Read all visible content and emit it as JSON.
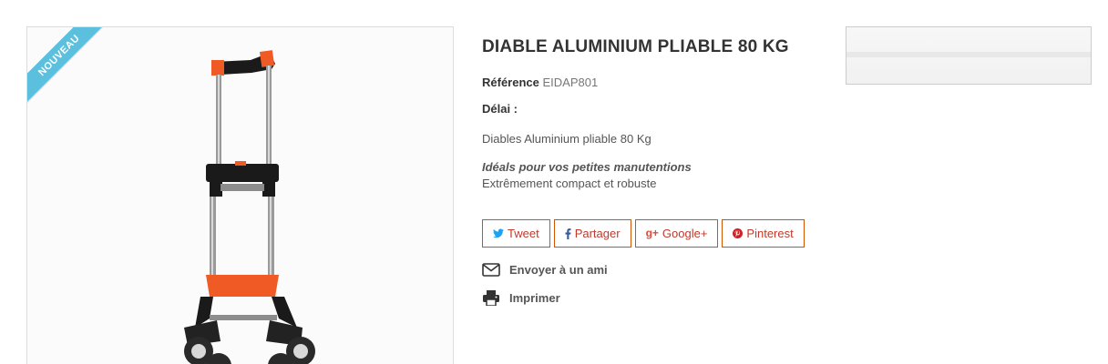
{
  "product": {
    "badge": "NOUVEAU",
    "title": "DIABLE ALUMINIUM PLIABLE 80 KG",
    "reference_label": "Référence",
    "reference_value": "EIDAP801",
    "delai_label": "Délai :",
    "short_description": "Diables Aluminium pliable 80 Kg",
    "highlight": "Idéals pour vos petites manutentions",
    "highlight_sub": "Extrêmement compact et robuste"
  },
  "share": {
    "buttons": [
      {
        "label": "Tweet",
        "icon": "twitter-icon"
      },
      {
        "label": "Partager",
        "icon": "facebook-icon"
      },
      {
        "label": "Google+",
        "icon": "google-plus-icon"
      },
      {
        "label": "Pinterest",
        "icon": "pinterest-icon"
      }
    ]
  },
  "actions": {
    "send_friend": "Envoyer à un ami",
    "print": "Imprimer"
  },
  "colors": {
    "accent": "#d35400",
    "badge": "#5bc0de",
    "handle": "#f05a24"
  }
}
